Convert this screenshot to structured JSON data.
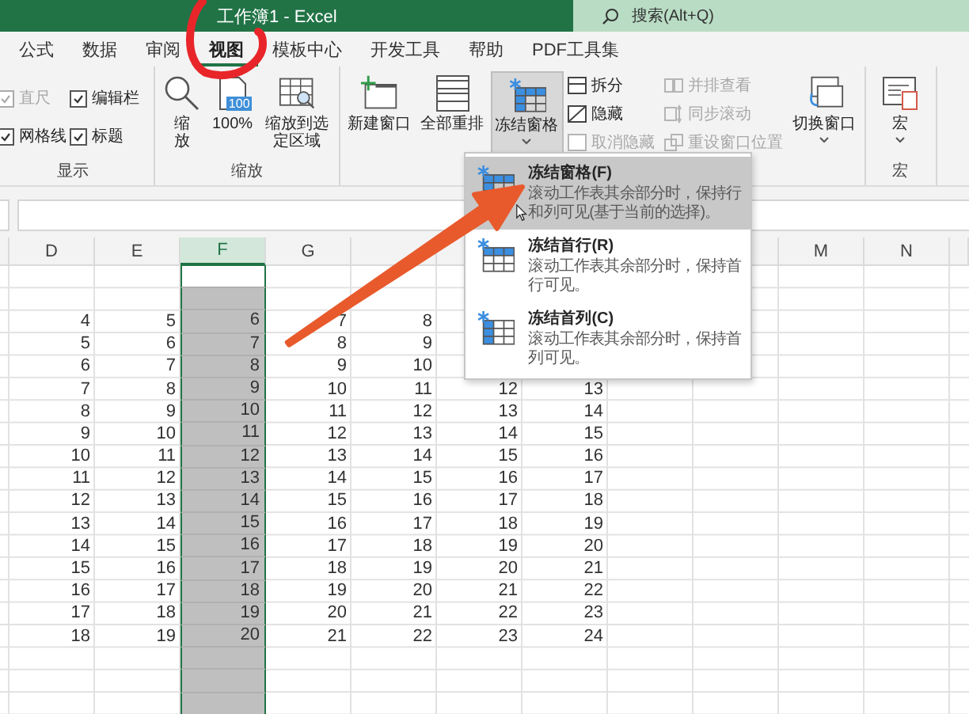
{
  "window": {
    "title": "工作簿1 - Excel"
  },
  "search": {
    "placeholder": "搜索(Alt+Q)"
  },
  "tabs": [
    {
      "label": "公式",
      "selected": false
    },
    {
      "label": "数据",
      "selected": false
    },
    {
      "label": "审阅",
      "selected": false
    },
    {
      "label": "视图",
      "selected": true
    },
    {
      "label": "模板中心",
      "selected": false
    },
    {
      "label": "开发工具",
      "selected": false
    },
    {
      "label": "帮助",
      "selected": false
    },
    {
      "label": "PDF工具集",
      "selected": false
    }
  ],
  "ribbon": {
    "display": {
      "label": "显示",
      "options": [
        {
          "label": "直尺",
          "checked": true,
          "disabled": true
        },
        {
          "label": "编辑栏",
          "checked": true,
          "disabled": false
        },
        {
          "label": "网格线",
          "checked": true,
          "disabled": false
        },
        {
          "label": "标题",
          "checked": true,
          "disabled": false
        }
      ]
    },
    "zoom": {
      "label": "缩放",
      "buttons": [
        {
          "kind": "zoom",
          "label": "缩放"
        },
        {
          "kind": "hundred",
          "label": "100%",
          "icon_text": "100"
        },
        {
          "kind": "fit",
          "label": "缩放到选定区域"
        }
      ]
    },
    "window": {
      "buttons": [
        {
          "kind": "new",
          "label": "新建窗口",
          "pressed": false,
          "menu": false
        },
        {
          "kind": "arrange",
          "label": "全部重排",
          "pressed": false,
          "menu": false
        },
        {
          "kind": "freeze",
          "label": "冻结窗格",
          "pressed": true,
          "menu": true
        }
      ],
      "pane_tools": [
        {
          "kind": "split",
          "label": "拆分",
          "disabled": false
        },
        {
          "kind": "hide",
          "label": "隐藏",
          "disabled": false
        },
        {
          "kind": "unhide",
          "label": "取消隐藏",
          "disabled": true
        }
      ],
      "compare_tools": [
        {
          "kind": "side",
          "label": "并排查看",
          "disabled": true
        },
        {
          "kind": "sync",
          "label": "同步滚动",
          "disabled": true
        },
        {
          "kind": "reset",
          "label": "重设窗口位置",
          "disabled": true
        }
      ],
      "switch": {
        "label": "切换窗口",
        "menu": true
      }
    },
    "macros": {
      "label": "宏",
      "button": {
        "label": "宏",
        "menu": true
      }
    }
  },
  "freeze_menu": {
    "items": [
      {
        "kind": "panes",
        "title": "冻结窗格(F)",
        "description": "滚动工作表其余部分时，保持行和列可见(基于当前的选择)。",
        "selected": true
      },
      {
        "kind": "top-row",
        "title": "冻结首行(R)",
        "description": "滚动工作表其余部分时，保持首行可见。",
        "selected": false
      },
      {
        "kind": "first-column",
        "title": "冻结首列(C)",
        "description": "滚动工作表其余部分时，保持首列可见。",
        "selected": false
      }
    ]
  },
  "sheet": {
    "columns": [
      {
        "selected": false
      },
      {
        "label": "D",
        "selected": false
      },
      {
        "label": "E",
        "selected": false
      },
      {
        "label": "F",
        "selected": true
      },
      {
        "label": "G",
        "selected": false
      },
      {
        "selected": false
      },
      {
        "selected": false
      },
      {},
      {},
      {
        "selected": false
      },
      {
        "label": "M",
        "selected": false
      },
      {
        "label": "N",
        "selected": false
      },
      {
        "selected": false
      }
    ],
    "rows": [
      {
        "active": true,
        "cells": [
          null,
          null,
          null,
          null,
          null,
          null,
          null,
          null,
          null,
          null,
          null,
          null,
          null
        ]
      },
      {
        "active": false,
        "cells": [
          null,
          null,
          null,
          null,
          null,
          null,
          null,
          null,
          null,
          null,
          null,
          null,
          null
        ]
      },
      {
        "active": false,
        "cells": [
          null,
          "4",
          "5",
          "6",
          "7",
          "8",
          null,
          null,
          null,
          null,
          null,
          null,
          null
        ]
      },
      {
        "active": false,
        "cells": [
          null,
          "5",
          "6",
          "7",
          "8",
          "9",
          null,
          null,
          null,
          null,
          null,
          null,
          null
        ]
      },
      {
        "active": false,
        "cells": [
          null,
          "6",
          "7",
          "8",
          "9",
          "10",
          null,
          null,
          null,
          null,
          null,
          null,
          null
        ]
      },
      {
        "active": false,
        "cells": [
          null,
          "7",
          "8",
          "9",
          "10",
          "11",
          "12",
          "13",
          null,
          null,
          null,
          null,
          null
        ]
      },
      {
        "active": false,
        "cells": [
          null,
          "8",
          "9",
          "10",
          "11",
          "12",
          "13",
          "14",
          null,
          null,
          null,
          null,
          null
        ]
      },
      {
        "active": false,
        "cells": [
          null,
          "9",
          "10",
          "11",
          "12",
          "13",
          "14",
          "15",
          null,
          null,
          null,
          null,
          null
        ]
      },
      {
        "active": false,
        "cells": [
          null,
          "10",
          "11",
          "12",
          "13",
          "14",
          "15",
          "16",
          null,
          null,
          null,
          null,
          null
        ]
      },
      {
        "active": false,
        "cells": [
          null,
          "11",
          "12",
          "13",
          "14",
          "15",
          "16",
          "17",
          null,
          null,
          null,
          null,
          null
        ]
      },
      {
        "active": false,
        "cells": [
          null,
          "12",
          "13",
          "14",
          "15",
          "16",
          "17",
          "18",
          null,
          null,
          null,
          null,
          null
        ]
      },
      {
        "active": false,
        "cells": [
          null,
          "13",
          "14",
          "15",
          "16",
          "17",
          "18",
          "19",
          null,
          null,
          null,
          null,
          null
        ]
      },
      {
        "active": false,
        "cells": [
          null,
          "14",
          "15",
          "16",
          "17",
          "18",
          "19",
          "20",
          null,
          null,
          null,
          null,
          null
        ]
      },
      {
        "active": false,
        "cells": [
          null,
          "15",
          "16",
          "17",
          "18",
          "19",
          "20",
          "21",
          null,
          null,
          null,
          null,
          null
        ]
      },
      {
        "active": false,
        "cells": [
          null,
          "16",
          "17",
          "18",
          "19",
          "20",
          "21",
          "22",
          null,
          null,
          null,
          null,
          null
        ]
      },
      {
        "active": false,
        "cells": [
          null,
          "17",
          "18",
          "19",
          "20",
          "21",
          "22",
          "23",
          null,
          null,
          null,
          null,
          null
        ]
      },
      {
        "active": false,
        "cells": [
          null,
          "18",
          "19",
          "20",
          "21",
          "22",
          "23",
          "24",
          null,
          null,
          null,
          null,
          null
        ]
      },
      {
        "active": false,
        "cells": [
          null,
          null,
          null,
          null,
          null,
          null,
          null,
          null,
          null,
          null,
          null,
          null,
          null
        ]
      },
      {
        "active": false,
        "cells": [
          null,
          null,
          null,
          null,
          null,
          null,
          null,
          null,
          null,
          null,
          null,
          null,
          null
        ]
      },
      {
        "active": false,
        "cells": [
          null,
          null,
          null,
          null,
          null,
          null,
          null,
          null,
          null,
          null,
          null,
          null,
          null
        ]
      }
    ]
  }
}
